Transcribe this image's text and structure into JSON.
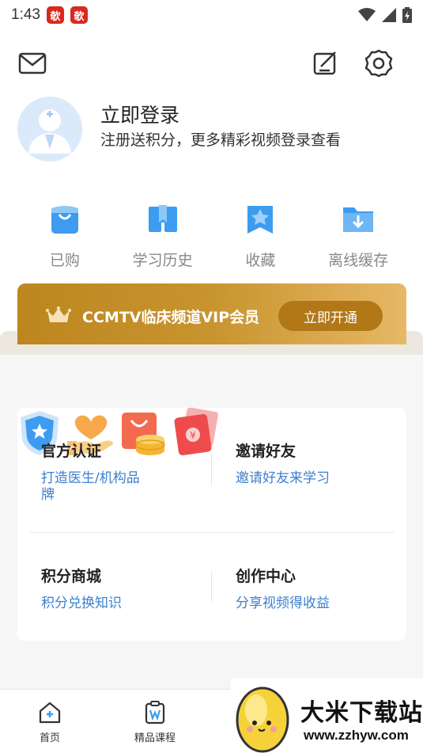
{
  "status_bar": {
    "time": "1:43",
    "badge_char": "欹"
  },
  "header": {
    "mail_icon": "mail-icon",
    "edit_icon": "edit-icon",
    "settings_icon": "gear-icon"
  },
  "profile": {
    "title": "立即登录",
    "subtitle": "注册送积分，更多精彩视频登录查看"
  },
  "quick_actions": [
    {
      "label": "已购",
      "icon": "shopping-bag-icon"
    },
    {
      "label": "学习历史",
      "icon": "book-icon"
    },
    {
      "label": "收藏",
      "icon": "star-bookmark-icon"
    },
    {
      "label": "离线缓存",
      "icon": "download-folder-icon"
    }
  ],
  "vip": {
    "text": "CCMTV临床频道VIP会员",
    "button": "立即开通"
  },
  "services": [
    {
      "title": "官方认证",
      "subtitle": "打造医生/机构品牌",
      "icon": "shield-star-icon"
    },
    {
      "title": "邀请好友",
      "subtitle": "邀请好友来学习",
      "icon": "heart-hand-icon"
    },
    {
      "title": "积分商城",
      "subtitle": "积分兑换知识",
      "icon": "shop-coins-icon"
    },
    {
      "title": "创作中心",
      "subtitle": "分享视频得收益",
      "icon": "red-envelope-icon"
    }
  ],
  "tabs": [
    {
      "label": "首页",
      "icon": "home-icon"
    },
    {
      "label": "精品课程",
      "icon": "course-icon"
    }
  ],
  "watermark": {
    "title": "大米下载站",
    "url": "www.zzhyw.com"
  },
  "colors": {
    "accent_blue": "#3b7fd0",
    "vip_gold": "#c8942e",
    "icon_blue": "#3d9cf0"
  }
}
